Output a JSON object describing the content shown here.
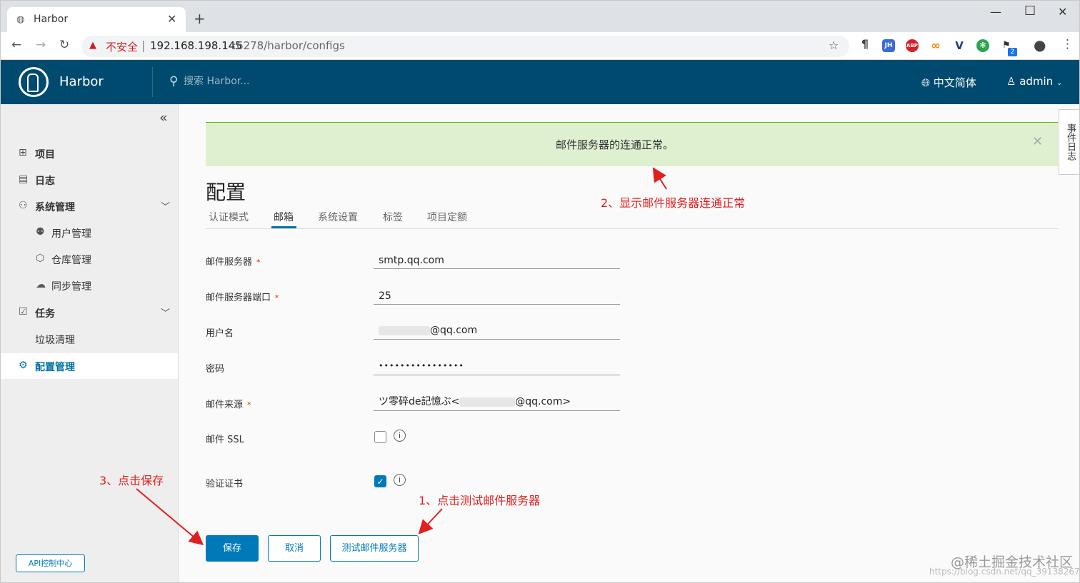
{
  "browser": {
    "tab_title": "Harbor",
    "new_tab": "+",
    "insecure_label": "不安全",
    "url_host": "192.168.198.145",
    "url_path": ":6278/harbor/configs",
    "ext_icons": [
      "pilcrow-icon",
      "jh-extension-icon",
      "abp-icon",
      "infinity-extension-icon",
      "vue-devtools-icon",
      "chrome-extension-icon",
      "extension-badge-icon"
    ],
    "ext_badge": "2"
  },
  "header": {
    "brand": "Harbor",
    "search_placeholder": "搜索 Harbor...",
    "language": "中文简体",
    "user": "admin"
  },
  "sidebar": {
    "items": [
      {
        "label": "项目",
        "icon": "projects-icon"
      },
      {
        "label": "日志",
        "icon": "logs-icon"
      },
      {
        "label": "系统管理",
        "icon": "admin-icon"
      },
      {
        "label": "用户管理",
        "icon": "users-icon"
      },
      {
        "label": "仓库管理",
        "icon": "registry-icon"
      },
      {
        "label": "同步管理",
        "icon": "replication-icon"
      },
      {
        "label": "任务",
        "icon": "tasks-icon"
      },
      {
        "label": "垃圾清理"
      },
      {
        "label": "配置管理",
        "icon": "gear-icon"
      }
    ],
    "api_button": "API控制中心"
  },
  "alert": {
    "message": "邮件服务器的连通正常。"
  },
  "page_title": "配置",
  "tabs": [
    "认证模式",
    "邮箱",
    "系统设置",
    "标签",
    "项目定额"
  ],
  "active_tab": "邮箱",
  "form": {
    "smtp_server_label": "邮件服务器",
    "smtp_server_value": "smtp.qq.com",
    "smtp_port_label": "邮件服务器端口",
    "smtp_port_value": "25",
    "username_label": "用户名",
    "username_suffix": "@qq.com",
    "password_label": "密码",
    "password_value": "••••••••••••••••",
    "from_label": "邮件来源",
    "from_prefix": "ツ零碎de記憶ぶ<",
    "from_suffix": "@qq.com>",
    "ssl_label": "邮件 SSL",
    "ssl_checked": false,
    "verify_label": "验证证书",
    "verify_checked": true,
    "required_mark": "*"
  },
  "buttons": {
    "save": "保存",
    "cancel": "取消",
    "test": "测试邮件服务器"
  },
  "event_tab": "事件日志",
  "annotations": {
    "a1": "1、点击测试邮件服务器",
    "a2": "2、显示邮件服务器连通正常",
    "a3": "3、点击保存"
  },
  "watermark": "@稀土掘金技术社区",
  "watermark_url": "https://blog.csdn.net/qq_39138267",
  "colors": {
    "header": "#004a70",
    "accent": "#0079b8",
    "success_bg": "#dff0d0",
    "annotation": "#e02020"
  }
}
